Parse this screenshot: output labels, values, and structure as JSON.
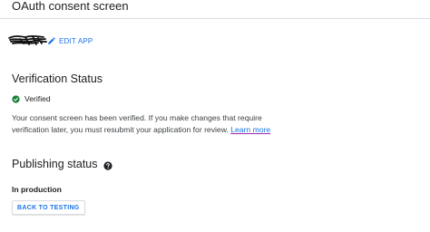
{
  "header": {
    "title": "OAuth consent screen"
  },
  "app": {
    "name_icon": "redacted-scribble",
    "edit_label": "EDIT APP",
    "edit_icon": "pencil-icon"
  },
  "verification": {
    "title": "Verification Status",
    "status_icon": "check-circle-icon",
    "status_color": "#188038",
    "status_label": "Verified",
    "description_line1": "Your consent screen has been verified. If you make changes that require",
    "description_line2": "verification later, you must resubmit your application for review.",
    "learn_more": "Learn more"
  },
  "publishing": {
    "title": "Publishing status",
    "help_icon": "help-icon",
    "status": "In production",
    "back_button": "BACK TO TESTING"
  },
  "colors": {
    "accent": "#1a73e8",
    "text": "#202124",
    "divider": "#dadce0"
  }
}
